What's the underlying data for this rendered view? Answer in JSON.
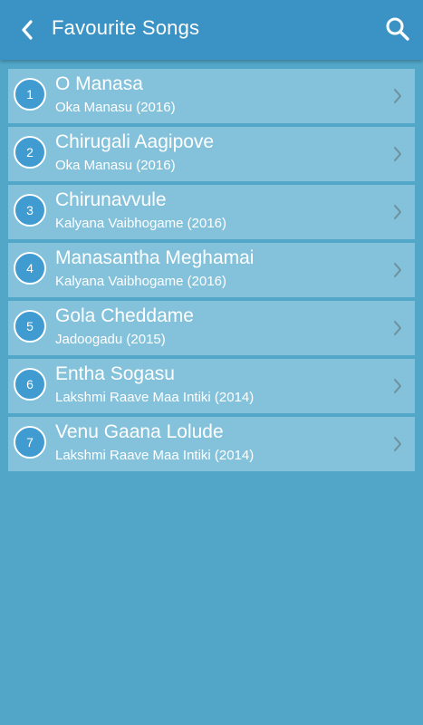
{
  "header": {
    "title": "Favourite Songs",
    "back_icon": "chevron-left-icon",
    "search_icon": "search-icon"
  },
  "songs": [
    {
      "number": "1",
      "title": "O Manasa",
      "subtitle": "Oka Manasu (2016)"
    },
    {
      "number": "2",
      "title": "Chirugali Aagipove",
      "subtitle": "Oka Manasu (2016)"
    },
    {
      "number": "3",
      "title": "Chirunavvule",
      "subtitle": "Kalyana Vaibhogame (2016)"
    },
    {
      "number": "4",
      "title": "Manasantha Meghamai",
      "subtitle": "Kalyana Vaibhogame (2016)"
    },
    {
      "number": "5",
      "title": "Gola Cheddame",
      "subtitle": "Jadoogadu (2015)"
    },
    {
      "number": "6",
      "title": "Entha Sogasu",
      "subtitle": "Lakshmi Raave Maa Intiki (2014)"
    },
    {
      "number": "7",
      "title": "Venu Gaana Lolude",
      "subtitle": "Lakshmi Raave Maa Intiki (2014)"
    }
  ],
  "colors": {
    "background": "#52a7c8",
    "appbar": "#3a93c4",
    "row": "#84c2dc",
    "badge": "#3f9bd0",
    "text": "#ffffff",
    "chevron": "#6e8f9c"
  }
}
